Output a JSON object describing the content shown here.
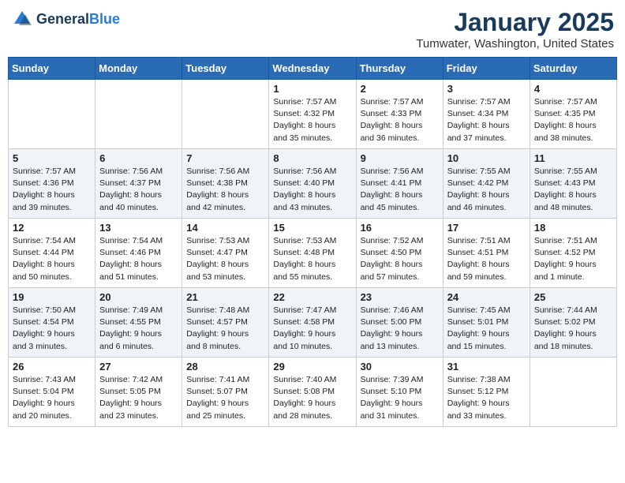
{
  "header": {
    "logo": {
      "general": "General",
      "blue": "Blue"
    },
    "month": "January 2025",
    "location": "Tumwater, Washington, United States"
  },
  "weekdays": [
    "Sunday",
    "Monday",
    "Tuesday",
    "Wednesday",
    "Thursday",
    "Friday",
    "Saturday"
  ],
  "weeks": [
    [
      {
        "day": "",
        "sunrise": "",
        "sunset": "",
        "daylight": ""
      },
      {
        "day": "",
        "sunrise": "",
        "sunset": "",
        "daylight": ""
      },
      {
        "day": "",
        "sunrise": "",
        "sunset": "",
        "daylight": ""
      },
      {
        "day": "1",
        "sunrise": "Sunrise: 7:57 AM",
        "sunset": "Sunset: 4:32 PM",
        "daylight": "Daylight: 8 hours and 35 minutes."
      },
      {
        "day": "2",
        "sunrise": "Sunrise: 7:57 AM",
        "sunset": "Sunset: 4:33 PM",
        "daylight": "Daylight: 8 hours and 36 minutes."
      },
      {
        "day": "3",
        "sunrise": "Sunrise: 7:57 AM",
        "sunset": "Sunset: 4:34 PM",
        "daylight": "Daylight: 8 hours and 37 minutes."
      },
      {
        "day": "4",
        "sunrise": "Sunrise: 7:57 AM",
        "sunset": "Sunset: 4:35 PM",
        "daylight": "Daylight: 8 hours and 38 minutes."
      }
    ],
    [
      {
        "day": "5",
        "sunrise": "Sunrise: 7:57 AM",
        "sunset": "Sunset: 4:36 PM",
        "daylight": "Daylight: 8 hours and 39 minutes."
      },
      {
        "day": "6",
        "sunrise": "Sunrise: 7:56 AM",
        "sunset": "Sunset: 4:37 PM",
        "daylight": "Daylight: 8 hours and 40 minutes."
      },
      {
        "day": "7",
        "sunrise": "Sunrise: 7:56 AM",
        "sunset": "Sunset: 4:38 PM",
        "daylight": "Daylight: 8 hours and 42 minutes."
      },
      {
        "day": "8",
        "sunrise": "Sunrise: 7:56 AM",
        "sunset": "Sunset: 4:40 PM",
        "daylight": "Daylight: 8 hours and 43 minutes."
      },
      {
        "day": "9",
        "sunrise": "Sunrise: 7:56 AM",
        "sunset": "Sunset: 4:41 PM",
        "daylight": "Daylight: 8 hours and 45 minutes."
      },
      {
        "day": "10",
        "sunrise": "Sunrise: 7:55 AM",
        "sunset": "Sunset: 4:42 PM",
        "daylight": "Daylight: 8 hours and 46 minutes."
      },
      {
        "day": "11",
        "sunrise": "Sunrise: 7:55 AM",
        "sunset": "Sunset: 4:43 PM",
        "daylight": "Daylight: 8 hours and 48 minutes."
      }
    ],
    [
      {
        "day": "12",
        "sunrise": "Sunrise: 7:54 AM",
        "sunset": "Sunset: 4:44 PM",
        "daylight": "Daylight: 8 hours and 50 minutes."
      },
      {
        "day": "13",
        "sunrise": "Sunrise: 7:54 AM",
        "sunset": "Sunset: 4:46 PM",
        "daylight": "Daylight: 8 hours and 51 minutes."
      },
      {
        "day": "14",
        "sunrise": "Sunrise: 7:53 AM",
        "sunset": "Sunset: 4:47 PM",
        "daylight": "Daylight: 8 hours and 53 minutes."
      },
      {
        "day": "15",
        "sunrise": "Sunrise: 7:53 AM",
        "sunset": "Sunset: 4:48 PM",
        "daylight": "Daylight: 8 hours and 55 minutes."
      },
      {
        "day": "16",
        "sunrise": "Sunrise: 7:52 AM",
        "sunset": "Sunset: 4:50 PM",
        "daylight": "Daylight: 8 hours and 57 minutes."
      },
      {
        "day": "17",
        "sunrise": "Sunrise: 7:51 AM",
        "sunset": "Sunset: 4:51 PM",
        "daylight": "Daylight: 8 hours and 59 minutes."
      },
      {
        "day": "18",
        "sunrise": "Sunrise: 7:51 AM",
        "sunset": "Sunset: 4:52 PM",
        "daylight": "Daylight: 9 hours and 1 minute."
      }
    ],
    [
      {
        "day": "19",
        "sunrise": "Sunrise: 7:50 AM",
        "sunset": "Sunset: 4:54 PM",
        "daylight": "Daylight: 9 hours and 3 minutes."
      },
      {
        "day": "20",
        "sunrise": "Sunrise: 7:49 AM",
        "sunset": "Sunset: 4:55 PM",
        "daylight": "Daylight: 9 hours and 6 minutes."
      },
      {
        "day": "21",
        "sunrise": "Sunrise: 7:48 AM",
        "sunset": "Sunset: 4:57 PM",
        "daylight": "Daylight: 9 hours and 8 minutes."
      },
      {
        "day": "22",
        "sunrise": "Sunrise: 7:47 AM",
        "sunset": "Sunset: 4:58 PM",
        "daylight": "Daylight: 9 hours and 10 minutes."
      },
      {
        "day": "23",
        "sunrise": "Sunrise: 7:46 AM",
        "sunset": "Sunset: 5:00 PM",
        "daylight": "Daylight: 9 hours and 13 minutes."
      },
      {
        "day": "24",
        "sunrise": "Sunrise: 7:45 AM",
        "sunset": "Sunset: 5:01 PM",
        "daylight": "Daylight: 9 hours and 15 minutes."
      },
      {
        "day": "25",
        "sunrise": "Sunrise: 7:44 AM",
        "sunset": "Sunset: 5:02 PM",
        "daylight": "Daylight: 9 hours and 18 minutes."
      }
    ],
    [
      {
        "day": "26",
        "sunrise": "Sunrise: 7:43 AM",
        "sunset": "Sunset: 5:04 PM",
        "daylight": "Daylight: 9 hours and 20 minutes."
      },
      {
        "day": "27",
        "sunrise": "Sunrise: 7:42 AM",
        "sunset": "Sunset: 5:05 PM",
        "daylight": "Daylight: 9 hours and 23 minutes."
      },
      {
        "day": "28",
        "sunrise": "Sunrise: 7:41 AM",
        "sunset": "Sunset: 5:07 PM",
        "daylight": "Daylight: 9 hours and 25 minutes."
      },
      {
        "day": "29",
        "sunrise": "Sunrise: 7:40 AM",
        "sunset": "Sunset: 5:08 PM",
        "daylight": "Daylight: 9 hours and 28 minutes."
      },
      {
        "day": "30",
        "sunrise": "Sunrise: 7:39 AM",
        "sunset": "Sunset: 5:10 PM",
        "daylight": "Daylight: 9 hours and 31 minutes."
      },
      {
        "day": "31",
        "sunrise": "Sunrise: 7:38 AM",
        "sunset": "Sunset: 5:12 PM",
        "daylight": "Daylight: 9 hours and 33 minutes."
      },
      {
        "day": "",
        "sunrise": "",
        "sunset": "",
        "daylight": ""
      }
    ]
  ]
}
